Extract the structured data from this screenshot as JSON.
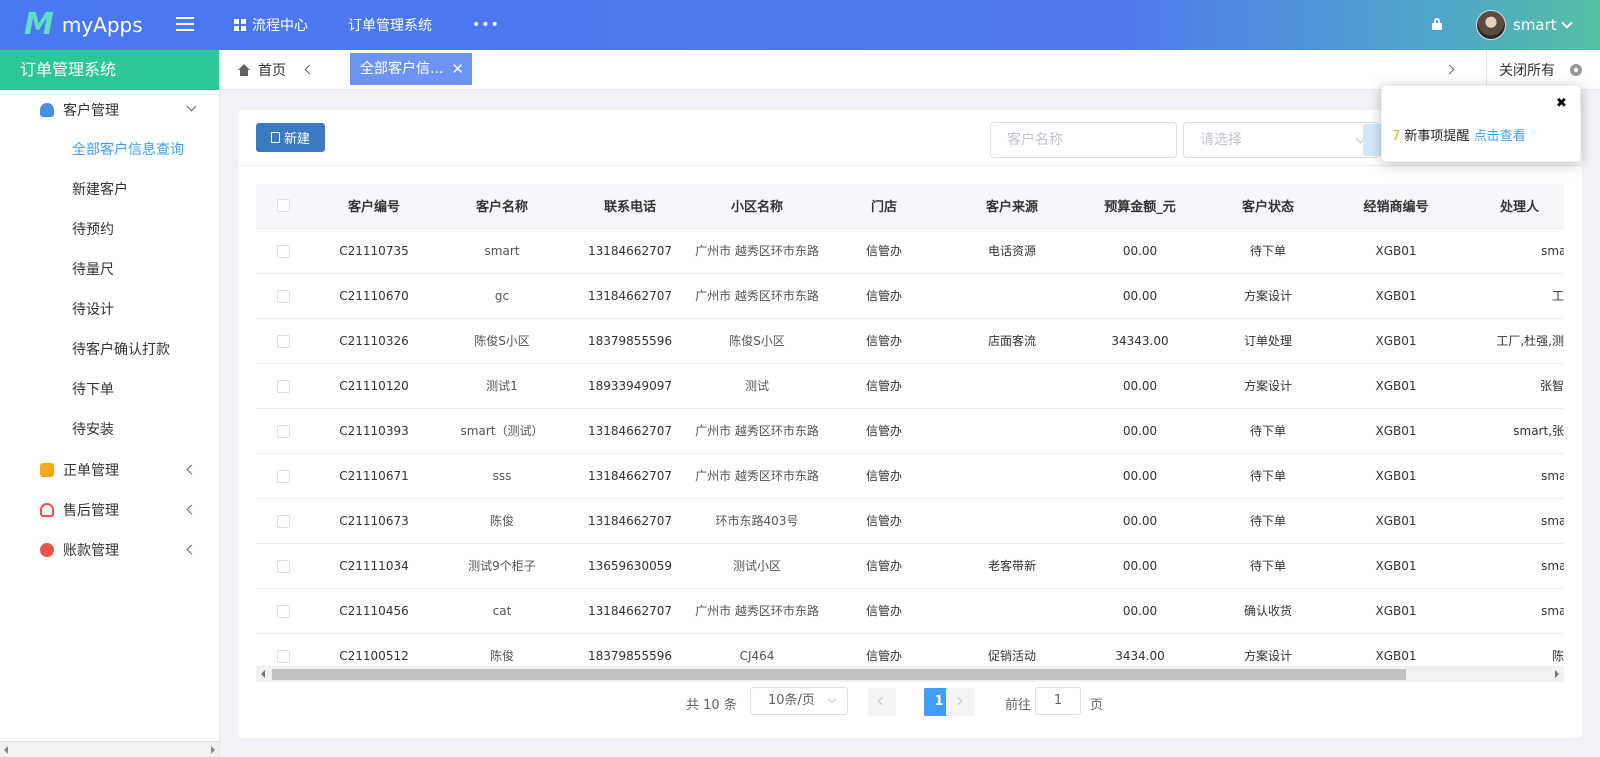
{
  "app": {
    "logo_mark": "M",
    "logo_text": "myApps"
  },
  "topnav": {
    "items": [
      {
        "label": "流程中心"
      },
      {
        "label": "订单管理系统"
      }
    ],
    "more": "•••"
  },
  "user": {
    "name": "smart"
  },
  "sidebar": {
    "title": "订单管理系统",
    "groups": [
      {
        "label": "客户管理",
        "icon": "user-group-icon",
        "color": "#4a90e2",
        "items": [
          "全部客户信息查询",
          "新建客户",
          "待预约",
          "待量尺",
          "待设计",
          "待客户确认打款",
          "待下单",
          "待安装"
        ]
      },
      {
        "label": "正单管理",
        "icon": "order-icon",
        "color": "#f5a623"
      },
      {
        "label": "售后管理",
        "icon": "headset-icon",
        "color": "#e8534a"
      },
      {
        "label": "账款管理",
        "icon": "coins-icon",
        "color": "#e8534a"
      }
    ]
  },
  "tabs": {
    "home": "首页",
    "active": "全部客户信...",
    "close_all": "关闭所有"
  },
  "toolbar": {
    "new_label": "新建",
    "search_placeholder": "客户名称",
    "select_placeholder": "请选择"
  },
  "table": {
    "columns": [
      "客户编号",
      "客户名称",
      "联系电话",
      "小区名称",
      "门店",
      "客户来源",
      "预算金额_元",
      "客户状态",
      "经销商编号",
      "处理人"
    ],
    "rows": [
      [
        "C21110735",
        "smart",
        "13184662707",
        "广州市 越秀区环市东路",
        "信管办",
        "电话资源",
        "00.00",
        "待下单",
        "XGB01",
        "smart"
      ],
      [
        "C21110670",
        "gc",
        "13184662707",
        "广州市 越秀区环市东路",
        "信管办",
        "",
        "00.00",
        "方案设计",
        "XGB01",
        "工厂"
      ],
      [
        "C21110326",
        "陈俊S小区",
        "18379855596",
        "陈俊S小区",
        "信管办",
        "店面客流",
        "34343.00",
        "订单处理",
        "XGB01",
        "工厂,杜强,测试"
      ],
      [
        "C21110120",
        "测试1",
        "18933949097",
        "测试",
        "信管办",
        "",
        "00.00",
        "方案设计",
        "XGB01",
        "张智旗"
      ],
      [
        "C21110393",
        "smart（测试）",
        "13184662707",
        "广州市 越秀区环市东路",
        "信管办",
        "",
        "00.00",
        "待下单",
        "XGB01",
        "smart,张智"
      ],
      [
        "C21110671",
        "sss",
        "13184662707",
        "广州市 越秀区环市东路",
        "信管办",
        "",
        "00.00",
        "待下单",
        "XGB01",
        "smart"
      ],
      [
        "C21110673",
        "陈俊",
        "13184662707",
        "环市东路403号",
        "信管办",
        "",
        "00.00",
        "待下单",
        "XGB01",
        "smart"
      ],
      [
        "C21111034",
        "测试9个柜子",
        "13659630059",
        "测试小区",
        "信管办",
        "老客带新",
        "00.00",
        "待下单",
        "XGB01",
        "smart"
      ],
      [
        "C21110456",
        "cat",
        "13184662707",
        "广州市 越秀区环市东路",
        "信管办",
        "",
        "00.00",
        "确认收货",
        "XGB01",
        "smart"
      ],
      [
        "C21100512",
        "陈俊",
        "18379855596",
        "CJ464",
        "信管办",
        "促销活动",
        "3434.00",
        "方案设计",
        "XGB01",
        "陈俊"
      ]
    ]
  },
  "pagination": {
    "total": "共 10 条",
    "page_size": "10条/页",
    "current": "1",
    "goto_prefix": "前往",
    "goto_value": "1",
    "goto_suffix": "页"
  },
  "notification": {
    "count": "7",
    "text": "新事项提醒",
    "link": "点击查看",
    "close": "✖"
  }
}
